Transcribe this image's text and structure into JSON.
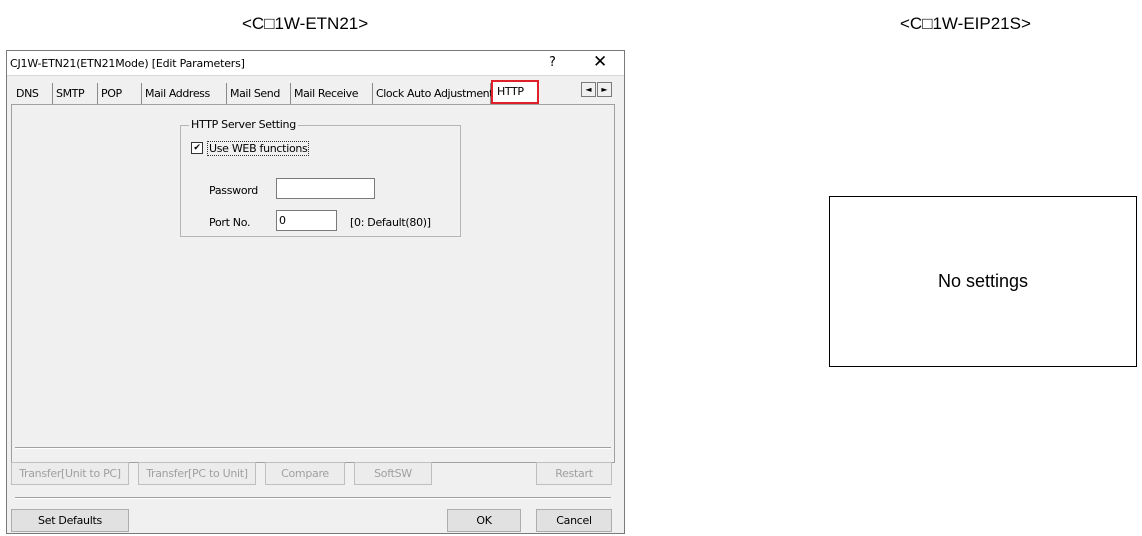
{
  "captions": {
    "left": "<C□1W-ETN21>",
    "right": "<C□1W-EIP21S>"
  },
  "dialog": {
    "title": "CJ1W-ETN21(ETN21Mode) [Edit Parameters]",
    "help_label": "?",
    "close_label": "✕",
    "tabs": [
      {
        "label": "DNS"
      },
      {
        "label": "SMTP"
      },
      {
        "label": "POP"
      },
      {
        "label": "Mail Address"
      },
      {
        "label": "Mail Send"
      },
      {
        "label": "Mail Receive"
      },
      {
        "label": "Clock Auto Adjustment"
      },
      {
        "label": "HTTP",
        "active": true
      }
    ],
    "tab_scroll": {
      "left": "◄",
      "right": "►"
    },
    "http_group": {
      "title": "HTTP Server Setting",
      "use_web_label": "Use WEB functions",
      "use_web_checked": true,
      "check_mark": "✔",
      "password_label": "Password",
      "password_value": "",
      "port_label": "Port No.",
      "port_value": "0",
      "port_hint": "[0: Default(80)]"
    },
    "buttons": {
      "transfer_unit_to_pc": "Transfer[Unit to PC]",
      "transfer_pc_to_unit": "Transfer[PC to Unit]",
      "compare": "Compare",
      "softsw": "SoftSW",
      "restart": "Restart",
      "set_defaults": "Set Defaults",
      "ok": "OK",
      "cancel": "Cancel"
    }
  },
  "right_panel": {
    "message": "No settings"
  },
  "colors": {
    "highlight": "#e0202a",
    "dialog_bg": "#f0f0f0"
  }
}
